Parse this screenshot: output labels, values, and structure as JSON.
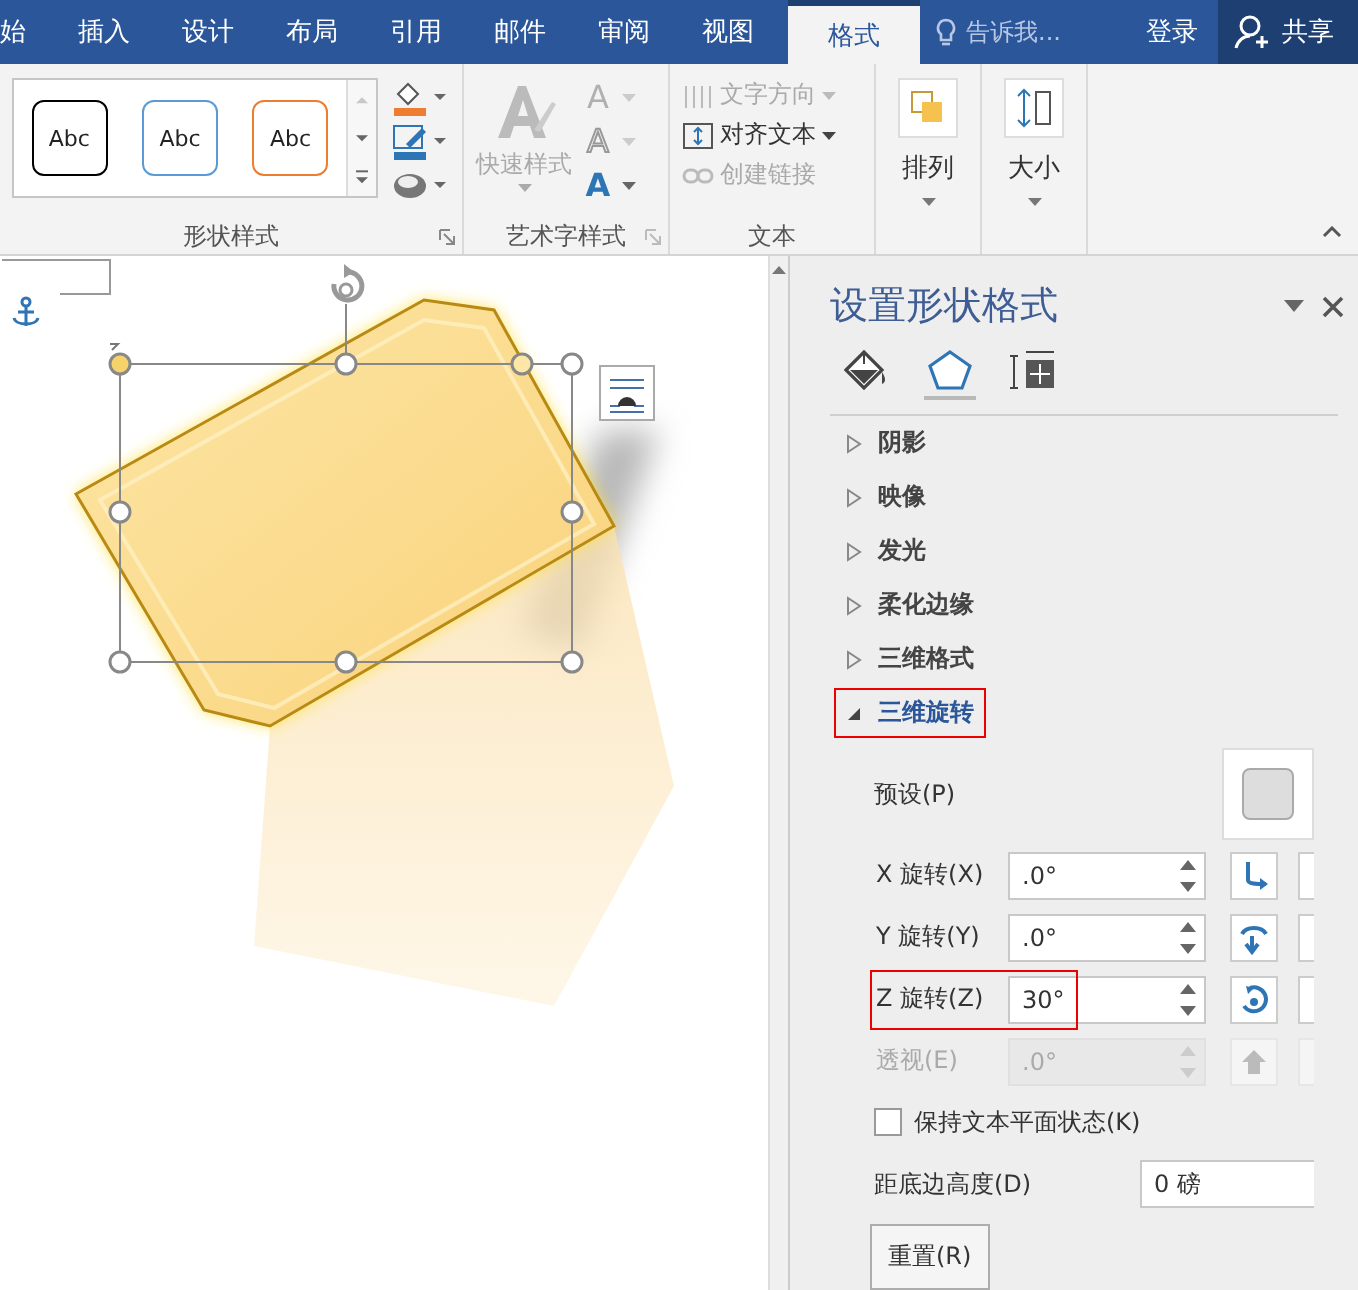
{
  "ribbon_tabs": [
    {
      "label": "始",
      "selected": false
    },
    {
      "label": "插入",
      "selected": false
    },
    {
      "label": "设计",
      "selected": false
    },
    {
      "label": "布局",
      "selected": false
    },
    {
      "label": "引用",
      "selected": false
    },
    {
      "label": "邮件",
      "selected": false
    },
    {
      "label": "审阅",
      "selected": false
    },
    {
      "label": "视图",
      "selected": false
    },
    {
      "label": "格式",
      "selected": true
    }
  ],
  "tell_me": {
    "placeholder": "告诉我..."
  },
  "sign_in": "登录",
  "share": "共享",
  "shape_styles": {
    "label": "形状样式",
    "samples": [
      {
        "label": "Abc",
        "color": "#000000"
      },
      {
        "label": "Abc",
        "color": "#5b9bd5"
      },
      {
        "label": "Abc",
        "color": "#ed7d31"
      }
    ]
  },
  "wordart_styles": {
    "label": "艺术字样式",
    "quick_styles": "快速样式",
    "letters": [
      {
        "kind": "fill",
        "label": "A"
      },
      {
        "kind": "outline",
        "label": "A"
      },
      {
        "kind": "effects",
        "label": "A"
      }
    ]
  },
  "text_group": {
    "label": "文本",
    "items": [
      {
        "kind": "direction",
        "label": "文字方向",
        "disabled": true
      },
      {
        "kind": "align",
        "label": "对齐文本",
        "disabled": false
      },
      {
        "kind": "link",
        "label": "创建链接",
        "disabled": true
      }
    ]
  },
  "arrange": "排列",
  "size": "大小",
  "pane": {
    "title": "设置形状格式",
    "tabs": [
      {
        "kind": "fill",
        "selected": false
      },
      {
        "kind": "effects",
        "selected": true
      },
      {
        "kind": "layout",
        "selected": false
      }
    ],
    "sections": [
      {
        "label": "阴影",
        "expanded": false,
        "highlighted": false
      },
      {
        "label": "映像",
        "expanded": false,
        "highlighted": false
      },
      {
        "label": "发光",
        "expanded": false,
        "highlighted": false
      },
      {
        "label": "柔化边缘",
        "expanded": false,
        "highlighted": false
      },
      {
        "label": "三维格式",
        "expanded": false,
        "highlighted": false
      },
      {
        "label": "三维旋转",
        "expanded": true,
        "highlighted": true
      }
    ],
    "preset_label": "预设(P)",
    "rotation": [
      {
        "kind": "x",
        "label": "X 旋转(X)",
        "value": ".0°",
        "disabled": false,
        "highlighted": false
      },
      {
        "kind": "y",
        "label": "Y 旋转(Y)",
        "value": ".0°",
        "disabled": false,
        "highlighted": false
      },
      {
        "kind": "z",
        "label": "Z 旋转(Z)",
        "value": "30°",
        "disabled": false,
        "highlighted": true
      },
      {
        "kind": "perspective",
        "label": "透视(E)",
        "value": ".0°",
        "disabled": true,
        "highlighted": false
      }
    ],
    "keep_flat": {
      "label": "保持文本平面状态(K)",
      "checked": false
    },
    "distance": {
      "label": "距底边高度(D)",
      "value": "0 磅"
    },
    "reset": "重置(R)"
  }
}
